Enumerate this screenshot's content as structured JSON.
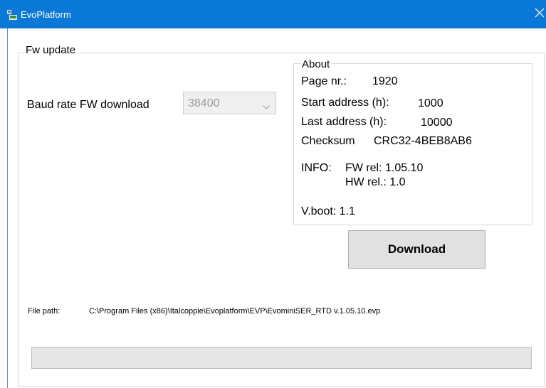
{
  "window": {
    "title": "EvoPlatform",
    "app_icon": "evoplatform-app-icon",
    "close_icon": "close-icon"
  },
  "fw_update": {
    "group_title": "Fw update",
    "baud_rate": {
      "label": "Baud rate FW download",
      "selected": "38400",
      "enabled": false
    }
  },
  "about": {
    "title": "About",
    "page_nr_label": "Page nr.:",
    "page_nr_value": "1920",
    "start_address_label": "Start address (h):",
    "start_address_value": "1000",
    "last_address_label": "Last address (h):",
    "last_address_value": "10000",
    "checksum_label": "Checksum",
    "checksum_value": "CRC32-4BEB8AB6",
    "info_label": "INFO:",
    "fw_rel": "FW rel: 1.05.10",
    "hw_rel": "HW rel.: 1.0",
    "vboot": "V.boot: 1.1"
  },
  "download_button": {
    "label": "Download"
  },
  "file_path": {
    "label": "File path:",
    "value": "C:\\Program Files (x86)\\Italcoppie\\Evoplatform\\EVP\\EvominiSER_RTD v.1.05.10.evp"
  },
  "progress": {
    "value_percent": 0
  }
}
